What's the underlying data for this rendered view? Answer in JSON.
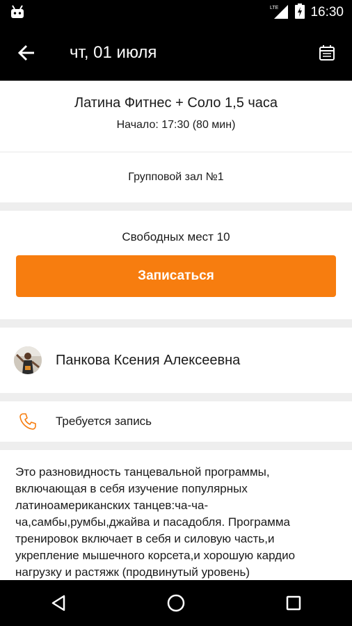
{
  "status_bar": {
    "time": "16:30",
    "network": "LTE",
    "icons": [
      "android-robot-icon",
      "signal-icon",
      "battery-icon"
    ]
  },
  "app_bar": {
    "title": "чт, 01 июля",
    "back_icon": "arrow-back-icon",
    "calendar_icon": "calendar-icon"
  },
  "class": {
    "title": "Латина Фитнес + Соло 1,5 часа",
    "start": "Начало: 17:30 (80 мин)",
    "hall": "Групповой зал №1"
  },
  "booking": {
    "free_places": "Свободных мест 10",
    "signup_label": "Записаться"
  },
  "trainer": {
    "name": "Панкова Ксения Алексеевна"
  },
  "requirement": {
    "text": "Требуется запись",
    "icon": "phone-icon"
  },
  "description": {
    "text": "Это разновидность танцевальной программы, включающая в себя изучение популярных латиноамериканских танцев:ча-ча-ча,самбы,румбы,джайва и пасадобля. Программа тренировок включает в себя и силовую часть,и укрепление мышечного корсета,и хорошую кардио нагрузку и растяжк (продвинутый уровень)"
  },
  "colors": {
    "accent": "#f77d0f",
    "bar_background": "#000000",
    "divider": "#eeeeee"
  },
  "nav_bar": {
    "icons": [
      "back-triangle-icon",
      "home-circle-icon",
      "recents-square-icon"
    ]
  }
}
